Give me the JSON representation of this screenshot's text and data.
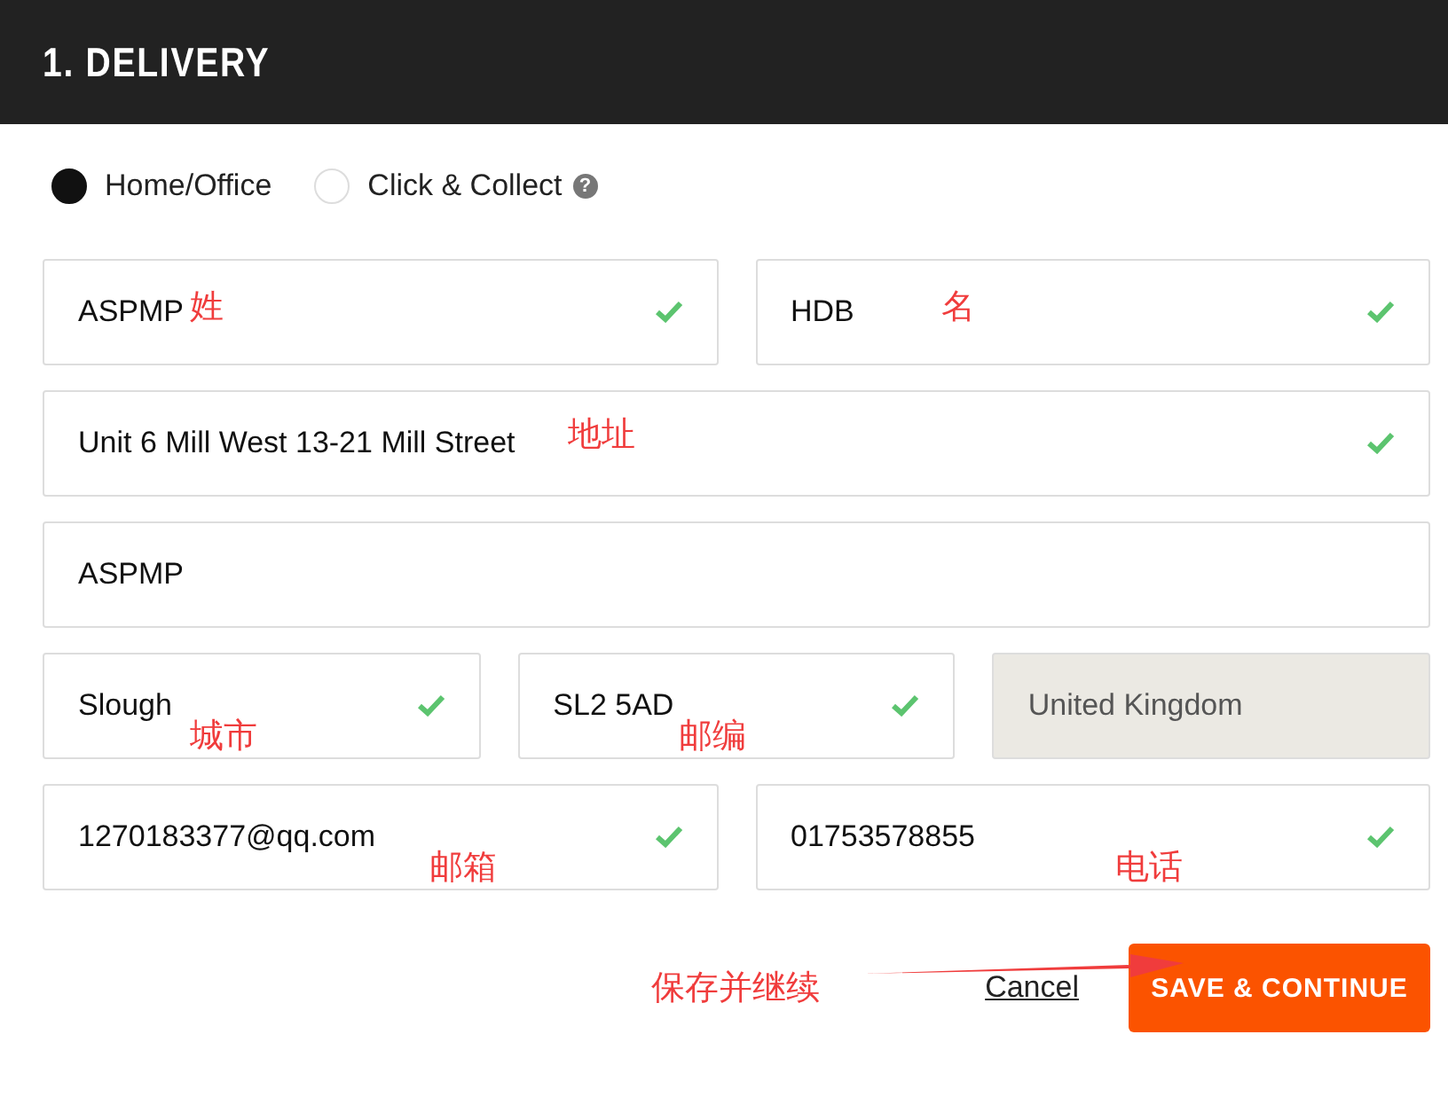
{
  "header": {
    "title": "1. DELIVERY"
  },
  "delivery_options": [
    {
      "label": "Home/Office",
      "selected": true,
      "help": false
    },
    {
      "label": "Click & Collect",
      "selected": false,
      "help": true
    }
  ],
  "help_icon": "?",
  "field_rows": [
    {
      "fields": [
        {
          "value": "ASPMP",
          "valid": true,
          "disabled": false,
          "note": "姓"
        },
        {
          "value": "HDB",
          "valid": true,
          "disabled": false,
          "note": "名"
        }
      ]
    },
    {
      "fields": [
        {
          "value": "Unit 6 Mill West 13-21 Mill Street",
          "valid": true,
          "disabled": false,
          "note": "地址"
        }
      ]
    },
    {
      "fields": [
        {
          "value": "ASPMP",
          "valid": false,
          "disabled": false
        }
      ]
    },
    {
      "fields": [
        {
          "value": "Slough",
          "valid": true,
          "disabled": false,
          "note": "城市"
        },
        {
          "value": "SL2 5AD",
          "valid": true,
          "disabled": false,
          "note": "邮编"
        },
        {
          "value": "United Kingdom",
          "valid": false,
          "disabled": true
        }
      ]
    },
    {
      "fields": [
        {
          "value": "1270183377@qq.com",
          "valid": true,
          "disabled": false,
          "note": "邮箱"
        },
        {
          "value": "01753578855",
          "valid": true,
          "disabled": false,
          "note": "电话"
        }
      ]
    }
  ],
  "footer": {
    "note": "保存并继续",
    "cancel": "Cancel",
    "submit": "SAVE & CONTINUE"
  }
}
